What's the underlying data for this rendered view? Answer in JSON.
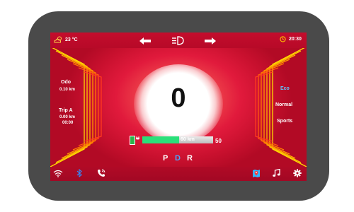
{
  "top": {
    "temperature": "23 °C",
    "clock": "20:30"
  },
  "speed": "0",
  "left_info": {
    "odo_label": "Odo",
    "odo_value": "0.10 km",
    "trip_label": "Trip A",
    "trip_distance": "0.00 km",
    "trip_time": "00:00"
  },
  "modes": [
    "Eco",
    "Normal",
    "Sports"
  ],
  "active_mode": "Eco",
  "range": {
    "value_text": "60 km",
    "max_text": "50",
    "fill_percent": 52
  },
  "gears": [
    "P",
    "D",
    "R"
  ],
  "active_gear": "D",
  "colors": {
    "accent": "#ffe600",
    "active_mode": "#5fc8ff",
    "active_gear": "#4aa6ff",
    "bar_fill": "#2ae07a"
  },
  "icons": [
    "cloud-sun-icon",
    "arrow-left-icon",
    "headlight-icon",
    "arrow-right-icon",
    "clock-icon",
    "wifi-icon",
    "bluetooth-icon",
    "phone-icon",
    "map-icon",
    "music-icon",
    "gear-icon"
  ]
}
